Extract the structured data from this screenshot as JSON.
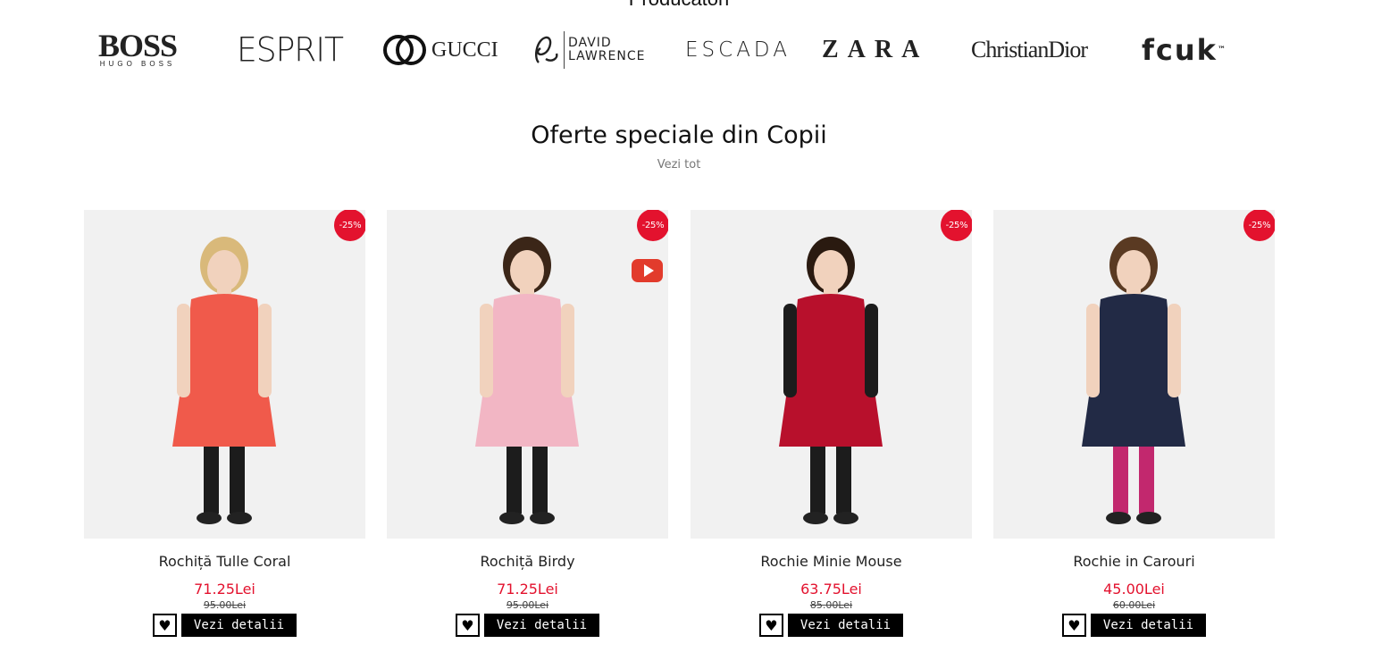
{
  "producers_heading": "Producatori",
  "brands": [
    {
      "name": "BOSS",
      "sub": "HUGO BOSS"
    },
    {
      "name": "ESPRIT"
    },
    {
      "name": "GUCCI"
    },
    {
      "name": "DAVID",
      "sub": "LAWRENCE"
    },
    {
      "name": "ESCADA"
    },
    {
      "name": "ZARA"
    },
    {
      "name": "ChristianDior"
    },
    {
      "name": "fcuk",
      "sup": "™"
    }
  ],
  "section": {
    "title": "Oferte speciale din Copii",
    "link": "Vezi tot"
  },
  "wishlist_icon": "heart-icon",
  "products": [
    {
      "name": "Rochiță Tulle Coral",
      "price": "71.25Lei",
      "old_price": "95.00Lei",
      "discount": "-25%",
      "details_label": "Vezi detalii",
      "dress_color": "#f05a4b"
    },
    {
      "name": "Rochiță Birdy",
      "price": "71.25Lei",
      "old_price": "95.00Lei",
      "discount": "-25%",
      "details_label": "Vezi detalii",
      "dress_color": "#f2b6c4",
      "has_video": true
    },
    {
      "name": "Rochie Minie Mouse",
      "price": "63.75Lei",
      "old_price": "85.00Lei",
      "discount": "-25%",
      "details_label": "Vezi detalii",
      "dress_color": "#b8102c"
    },
    {
      "name": "Rochie in Carouri",
      "price": "45.00Lei",
      "old_price": "60.00Lei",
      "discount": "-25%",
      "details_label": "Vezi detalii",
      "dress_color": "#222a45"
    }
  ]
}
